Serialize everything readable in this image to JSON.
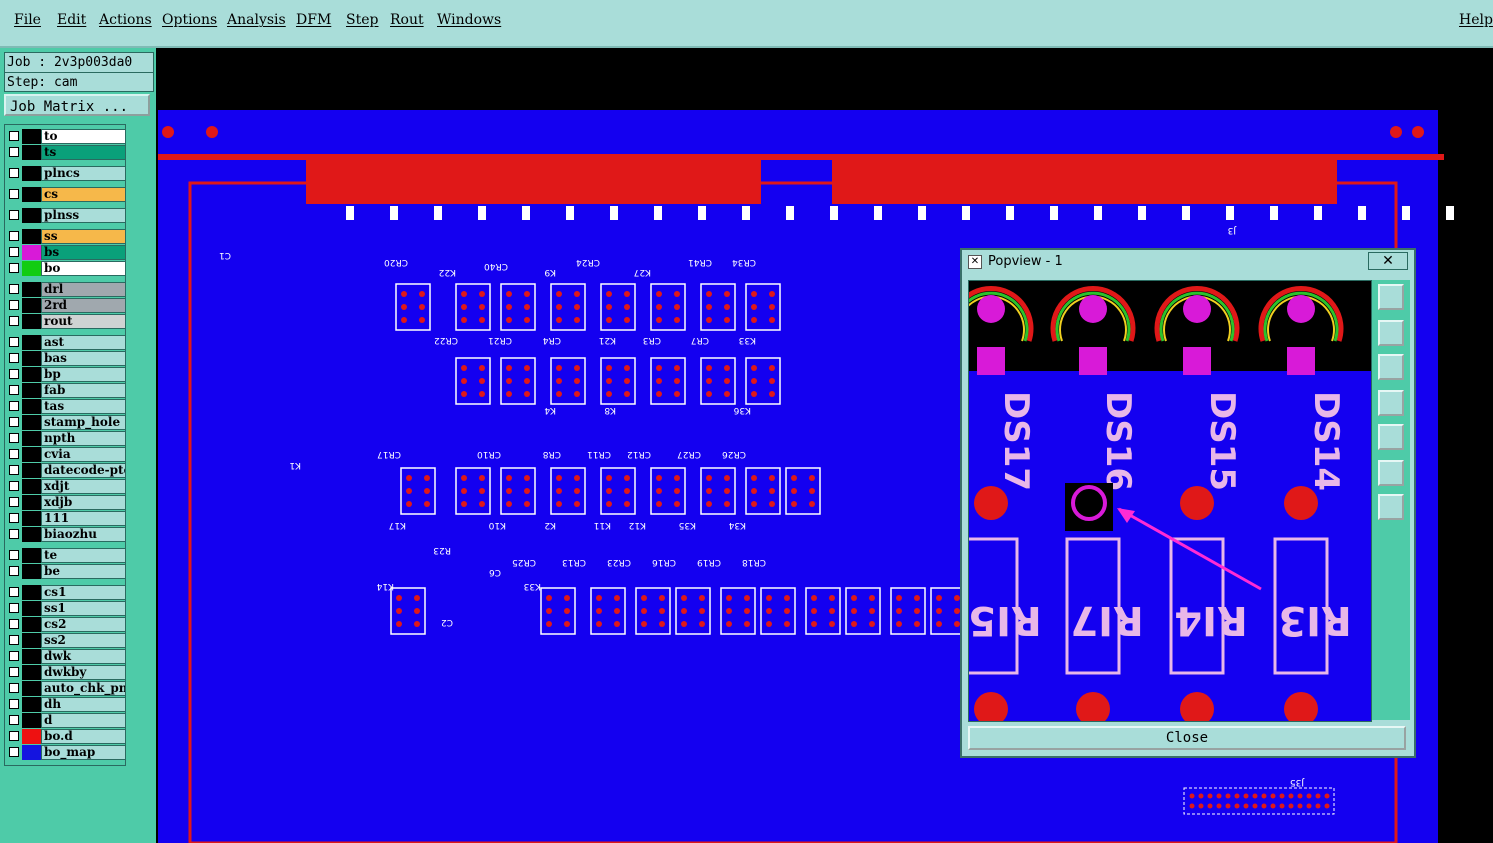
{
  "menu": {
    "items": [
      "File",
      "Edit",
      "Actions",
      "Options",
      "Analysis",
      "DFM",
      "Step",
      "Rout",
      "Windows"
    ],
    "help": "Help"
  },
  "job": {
    "job_line": "Job : 2v3p003da0",
    "step_line": "Step: cam",
    "matrix_button": "Job Matrix ..."
  },
  "layers": [
    {
      "name": "to",
      "color": "#000000",
      "bg": "#ffffff"
    },
    {
      "name": "ts",
      "color": "#000000",
      "bg": "#0aa07a"
    },
    {
      "name": "plncs",
      "color": "#000000",
      "bg": "#a9ddd9"
    },
    {
      "name": "cs",
      "color": "#000000",
      "bg": "#f6b84a"
    },
    {
      "name": "plnss",
      "color": "#000000",
      "bg": "#a9ddd9"
    },
    {
      "name": "ss",
      "color": "#000000",
      "bg": "#f6b84a"
    },
    {
      "name": "bs",
      "color": "#d81ad8",
      "bg": "#0aa07a"
    },
    {
      "name": "bo",
      "color": "#12cc12",
      "bg": "#ffffff"
    },
    {
      "name": "drl",
      "color": "#000000",
      "bg": "#a0a8ae"
    },
    {
      "name": "2rd",
      "color": "#000000",
      "bg": "#a0a8ae"
    },
    {
      "name": "rout",
      "color": "#000000",
      "bg": "#cfd3d3"
    },
    {
      "name": "ast",
      "color": "#000000",
      "bg": "#a9ddd9"
    },
    {
      "name": "bas",
      "color": "#000000",
      "bg": "#a9ddd9"
    },
    {
      "name": "bp",
      "color": "#000000",
      "bg": "#a9ddd9"
    },
    {
      "name": "fab",
      "color": "#000000",
      "bg": "#a9ddd9"
    },
    {
      "name": "tas",
      "color": "#000000",
      "bg": "#a9ddd9"
    },
    {
      "name": "stamp_hole",
      "color": "#000000",
      "bg": "#a9ddd9"
    },
    {
      "name": "npth",
      "color": "#000000",
      "bg": "#a9ddd9"
    },
    {
      "name": "cvia",
      "color": "#000000",
      "bg": "#a9ddd9"
    },
    {
      "name": "datecode-pte",
      "color": "#000000",
      "bg": "#a9ddd9"
    },
    {
      "name": "xdjt",
      "color": "#000000",
      "bg": "#a9ddd9"
    },
    {
      "name": "xdjb",
      "color": "#000000",
      "bg": "#a9ddd9"
    },
    {
      "name": "111",
      "color": "#000000",
      "bg": "#a9ddd9"
    },
    {
      "name": "biaozhu",
      "color": "#000000",
      "bg": "#a9ddd9"
    },
    {
      "name": "te",
      "color": "#000000",
      "bg": "#a9ddd9"
    },
    {
      "name": "be",
      "color": "#000000",
      "bg": "#a9ddd9"
    },
    {
      "name": "cs1",
      "color": "#000000",
      "bg": "#a9ddd9"
    },
    {
      "name": "ss1",
      "color": "#000000",
      "bg": "#a9ddd9"
    },
    {
      "name": "cs2",
      "color": "#000000",
      "bg": "#a9ddd9"
    },
    {
      "name": "ss2",
      "color": "#000000",
      "bg": "#a9ddd9"
    },
    {
      "name": "dwk",
      "color": "#000000",
      "bg": "#a9ddd9"
    },
    {
      "name": "dwkby",
      "color": "#000000",
      "bg": "#a9ddd9"
    },
    {
      "name": "auto_chk_pnl",
      "color": "#000000",
      "bg": "#a9ddd9"
    },
    {
      "name": "dh",
      "color": "#000000",
      "bg": "#a9ddd9"
    },
    {
      "name": "d",
      "color": "#000000",
      "bg": "#a9ddd9"
    },
    {
      "name": "bo.d",
      "color": "#ee1111",
      "bg": "#a9ddd9"
    },
    {
      "name": "bo_map",
      "color": "#1414e0",
      "bg": "#a9ddd9"
    }
  ],
  "popview": {
    "title": "Popview - 1",
    "close_label": "Close",
    "close_x": "✕",
    "labels": [
      "DS17",
      "DS16",
      "DS15",
      "DS14"
    ],
    "rlabels": [
      "RI5",
      "RI7",
      "RI4",
      "RI3"
    ]
  },
  "board": {
    "labels": [
      "CR20",
      "CR40",
      "CR24",
      "CR41",
      "CR34",
      "CR22",
      "CR21",
      "CR4",
      "CR3",
      "CR7",
      "K22",
      "K9",
      "K27",
      "K21",
      "K33",
      "K4",
      "K8",
      "K36",
      "K17",
      "K10",
      "K2",
      "K11",
      "K12",
      "K35",
      "K34",
      "K14",
      "K33",
      "CR17",
      "CR10",
      "CR8",
      "CR11",
      "CR12",
      "CR27",
      "CR26",
      "CR25",
      "CR13",
      "CR23",
      "CR16",
      "CR19",
      "CR18",
      "K1",
      "C1",
      "C2",
      "C6",
      "R23",
      "J3",
      "J35"
    ]
  },
  "colors": {
    "board": "#1400f0",
    "pad": "#e01818",
    "silk": "#ffffff",
    "panel": "#a9ddd9",
    "accent": "#4ecba8"
  }
}
